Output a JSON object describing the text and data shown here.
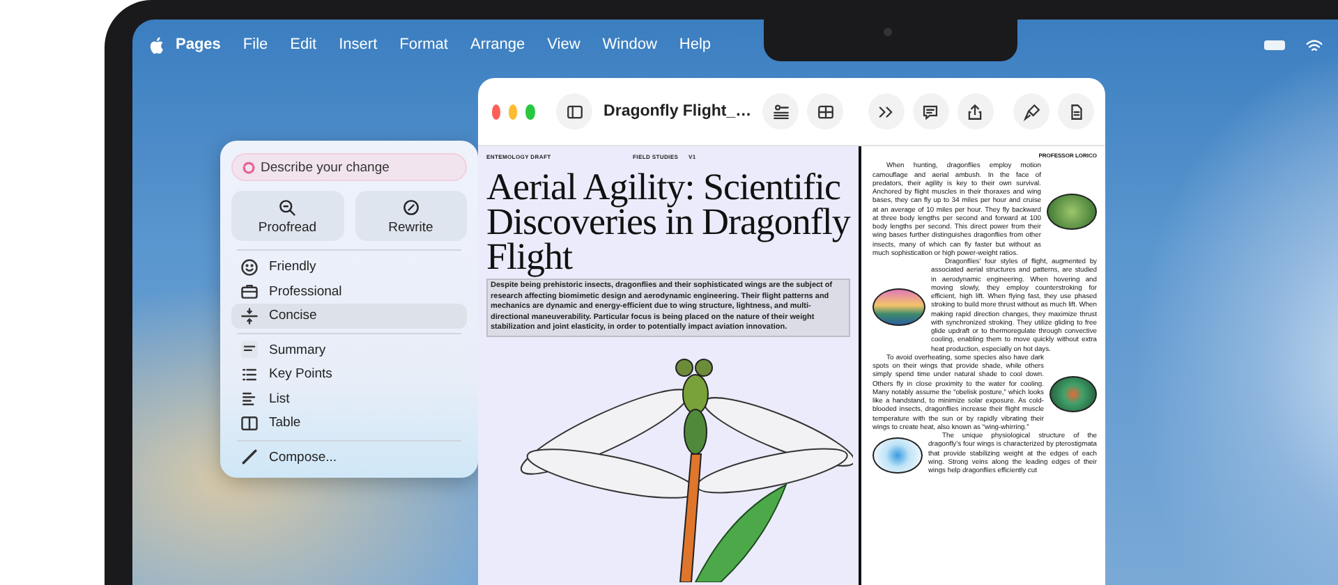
{
  "menu_bar": {
    "app_name": "Pages",
    "menus": [
      "File",
      "Edit",
      "Insert",
      "Format",
      "Arrange",
      "View",
      "Window",
      "Help"
    ]
  },
  "writing_tools": {
    "prompt_field": {
      "placeholder": "Describe your change"
    },
    "buttons": [
      "Proofread",
      "Rewrite"
    ],
    "tone_options": [
      {
        "label": "Friendly",
        "selected": false
      },
      {
        "label": "Professional",
        "selected": false
      },
      {
        "label": "Concise",
        "selected": true
      }
    ],
    "format_options": [
      {
        "label": "Summary",
        "selected": false
      },
      {
        "label": "Key Points",
        "selected": false
      },
      {
        "label": "List",
        "selected": false
      },
      {
        "label": "Table",
        "selected": false
      }
    ],
    "compose": {
      "label": "Compose..."
    }
  },
  "window": {
    "title": "Dragonfly Flight_…"
  },
  "left_page": {
    "header": [
      "ENTEMOLOGY DRAFT",
      "FIELD STUDIES",
      "V1"
    ],
    "title": "Aerial Agility: Scientific Discoveries in Dragonfly Flight",
    "abstract": {
      "text": "Despite being prehistoric insects, dragonflies and their sophisticated wings are the subject of research affecting biomimetic design and aerodynamic engineering. Their flight patterns and mechanics are dynamic and energy-efficient due to wing structure, lightness, and multi-directional maneuverability. Particular focus is being placed on the nature of their weight stabilization and joint elasticity, in order to potentially impact aviation innovation.",
      "selected": true
    }
  },
  "right_page": {
    "header": "PROFESSOR LORICO",
    "paragraphs": [
      "When hunting, dragonflies employ motion camouflage and aerial ambush. In the face of predators, their agility is key to their own survival. Anchored by flight muscles in their thoraxes and wing bases, they can fly up to 34 miles per hour and cruise at an average of 10 miles per hour. They fly backward at three body lengths per second and forward at 100 body lengths per second. This direct power from their wing bases further distinguishes dragonflies from other insects, many of which can fly faster but without as much sophistication or high power-weight ratios.",
      "Dragonflies’ four styles of flight, augmented by associated aerial structures and patterns, are studied in aerodynamic engineering. When hovering and moving slowly, they employ counterstroking for efficient, high lift. When flying fast, they use phased stroking to build more thrust without as much lift. When making rapid direction changes, they maximize thrust with synchronized stroking. They utilize gliding to free glide updraft or to thermoregulate through convective cooling, enabling them to move quickly without extra heat production, especially on hot days.",
      "To avoid overheating, some species also have dark spots on their wings that provide shade, while others simply spend time under natural shade to cool down. Others fly in close proximity to the water for cooling. Many notably assume the “obelisk posture,” which looks like a handstand, to minimize solar exposure. As cold-blooded insects, dragonflies increase their flight muscle temperature with the sun or by rapidly vibrating their wings to create heat, also known as “wing-whirring.”",
      "The unique physiological structure of the dragonfly’s four wings is characterized by pterostigmata that provide stabilizing weight at the edges of each wing. Strong veins along the leading edges of their wings help dragonflies efficiently cut"
    ]
  }
}
